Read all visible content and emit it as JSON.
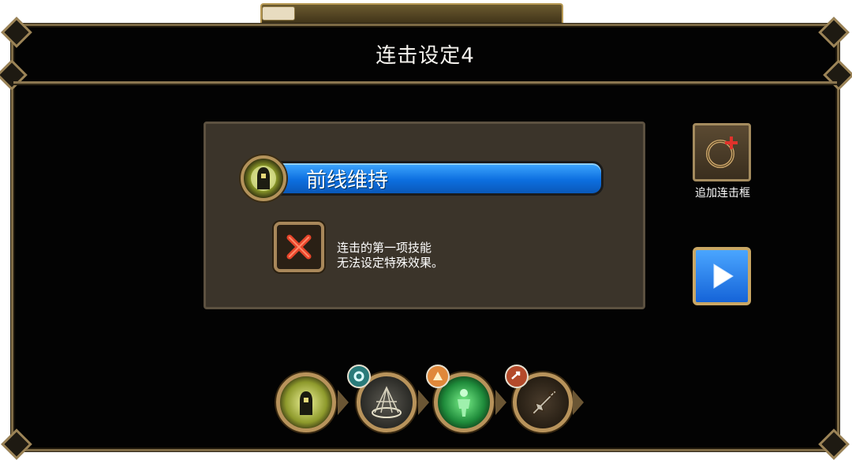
{
  "title": "连击设定4",
  "skill": {
    "name": "前线维持",
    "icon": "glowing-figure-icon"
  },
  "note_lines": [
    "连击的第一项技能",
    "无法设定特殊效果。"
  ],
  "buttons": {
    "add_combo_label": "追加连击框",
    "add_combo_icon": "ring-plus-icon",
    "next_icon": "play-icon",
    "disabled_effect_icon": "red-x-icon"
  },
  "chain": [
    {
      "icon": "glowing-figure-icon",
      "badge": null
    },
    {
      "icon": "cage-icon",
      "badge": "teal-gear-icon"
    },
    {
      "icon": "green-figure-icon",
      "badge": "orange-burst-icon"
    },
    {
      "icon": "kunai-icon",
      "badge": "red-arrow-icon"
    }
  ],
  "colors": {
    "panel_bg": "#030303",
    "frame_gold": "#b8935b",
    "skill_bar_blue": "#0d6fe0",
    "info_box_bg": "#3b342a",
    "x_red": "#e8452a"
  }
}
